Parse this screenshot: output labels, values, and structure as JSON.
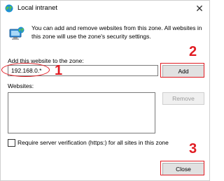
{
  "window": {
    "title": "Local intranet",
    "close_glyph": "✕"
  },
  "description": "You can add and remove websites from this zone. All websites in this zone will use the zone's security settings.",
  "add_site": {
    "label": "Add this website to the zone:",
    "value": "192.168.0.*",
    "button_label": "Add"
  },
  "websites": {
    "label": "Websites:",
    "items": [],
    "remove_label": "Remove"
  },
  "https_verify": {
    "label": "Require server verification (https:) for all sites in this zone",
    "checked": false
  },
  "close_label": "Close",
  "annotations": {
    "step1": "1",
    "step2": "2",
    "step3": "3",
    "color": "#e11b22"
  },
  "icons": [
    "globe-icon",
    "monitor-icon",
    "close-icon"
  ]
}
